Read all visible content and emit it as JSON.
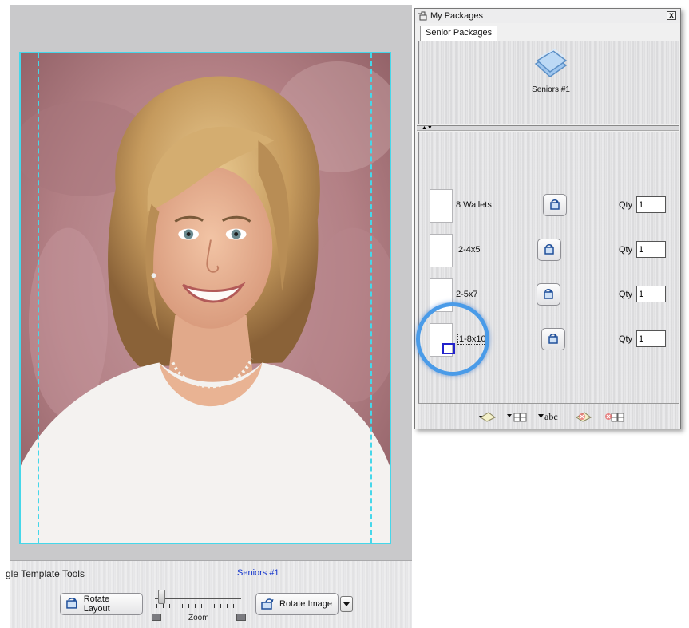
{
  "editor": {
    "tools_title": "gle Template Tools",
    "package_name": "Seniors #1",
    "rotate_layout_label": "Rotate Layout",
    "rotate_image_label": "Rotate Image",
    "zoom_label": "Zoom",
    "zoom_level": 0.05
  },
  "packages_window": {
    "title": "My Packages",
    "close_glyph": "x",
    "tabs": [
      {
        "label": "Senior Packages",
        "selected": true
      }
    ],
    "gallery": [
      {
        "label": "Seniors #1",
        "icon": "package-stack-icon"
      }
    ],
    "items": [
      {
        "label": "8 Wallets",
        "qty_label": "Qty",
        "qty": "1"
      },
      {
        "label": "2-4x5",
        "qty_label": "Qty",
        "qty": "1"
      },
      {
        "label": "2-5x7",
        "qty_label": "Qty",
        "qty": "1"
      },
      {
        "label": "1-8x10",
        "qty_label": "Qty",
        "qty": "1",
        "highlighted": true
      }
    ],
    "toolbar": {
      "rename_text": "abc",
      "icons": [
        "new-package-icon",
        "add-item-icon",
        "rename-icon",
        "delete-package-icon",
        "remove-item-icon"
      ]
    }
  },
  "colors": {
    "guide": "#45d7ea",
    "callout": "#4a9be8",
    "package_link": "#1133cc",
    "drop_marker": "#2222cc"
  }
}
